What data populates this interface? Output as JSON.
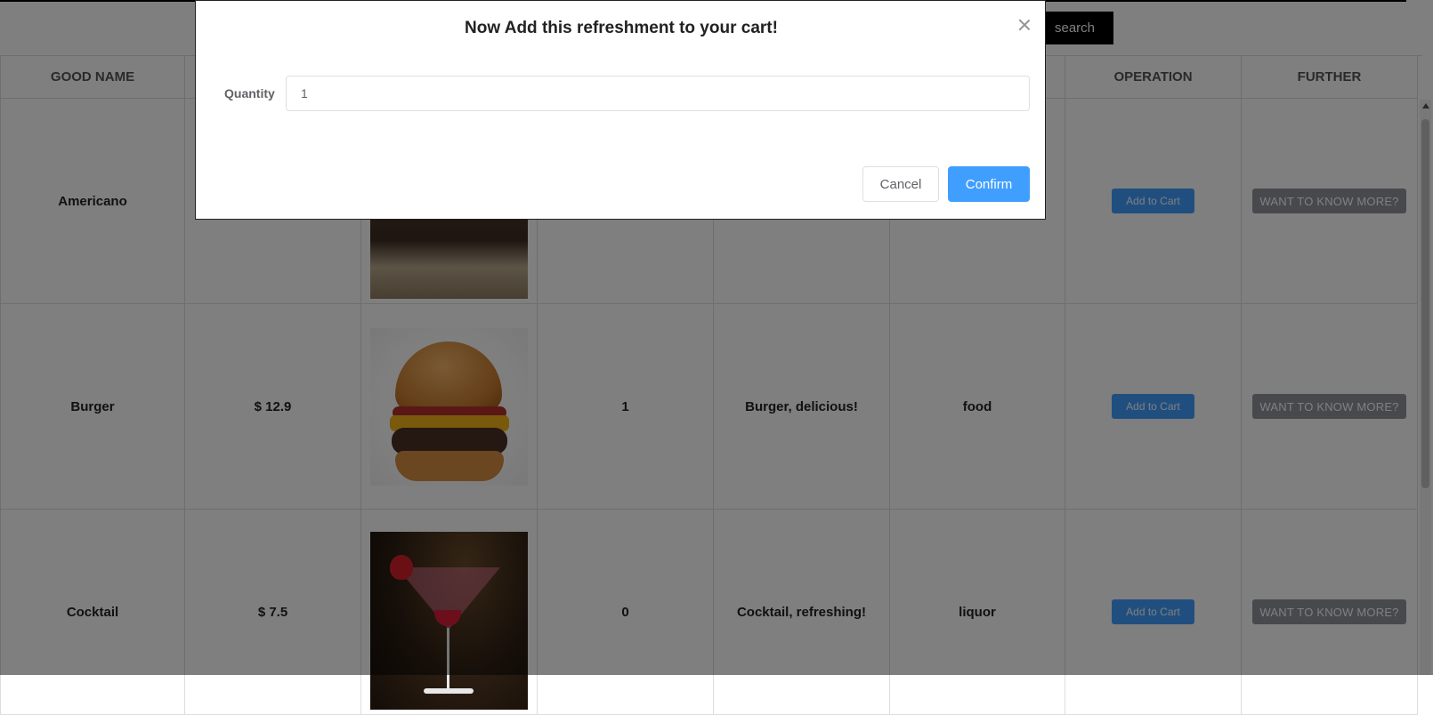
{
  "toolbar": {
    "search_label": "search"
  },
  "table": {
    "headers": [
      "GOOD NAME",
      "",
      "",
      "",
      "",
      "",
      "OPERATION",
      "FURTHER"
    ],
    "rows": [
      {
        "name": "Americano",
        "price": "",
        "stock": "",
        "description": "",
        "category": "",
        "add_label": "Add to Cart",
        "more_label": "WANT TO KNOW MORE?"
      },
      {
        "name": "Burger",
        "price": "$ 12.9",
        "stock": "1",
        "description": "Burger, delicious!",
        "category": "food",
        "add_label": "Add to Cart",
        "more_label": "WANT TO KNOW MORE?"
      },
      {
        "name": "Cocktail",
        "price": "$ 7.5",
        "stock": "0",
        "description": "Cocktail, refreshing!",
        "category": "liquor",
        "add_label": "Add to Cart",
        "more_label": "WANT TO KNOW MORE?"
      }
    ]
  },
  "dialog": {
    "title": "Now Add this refreshment to your cart!",
    "quantity_label": "Quantity",
    "quantity_value": "1",
    "cancel_label": "Cancel",
    "confirm_label": "Confirm"
  },
  "colors": {
    "primary": "#409eff",
    "info": "#909399",
    "search_bg": "#000000",
    "overlay": "rgba(0,0,0,0.5)"
  }
}
